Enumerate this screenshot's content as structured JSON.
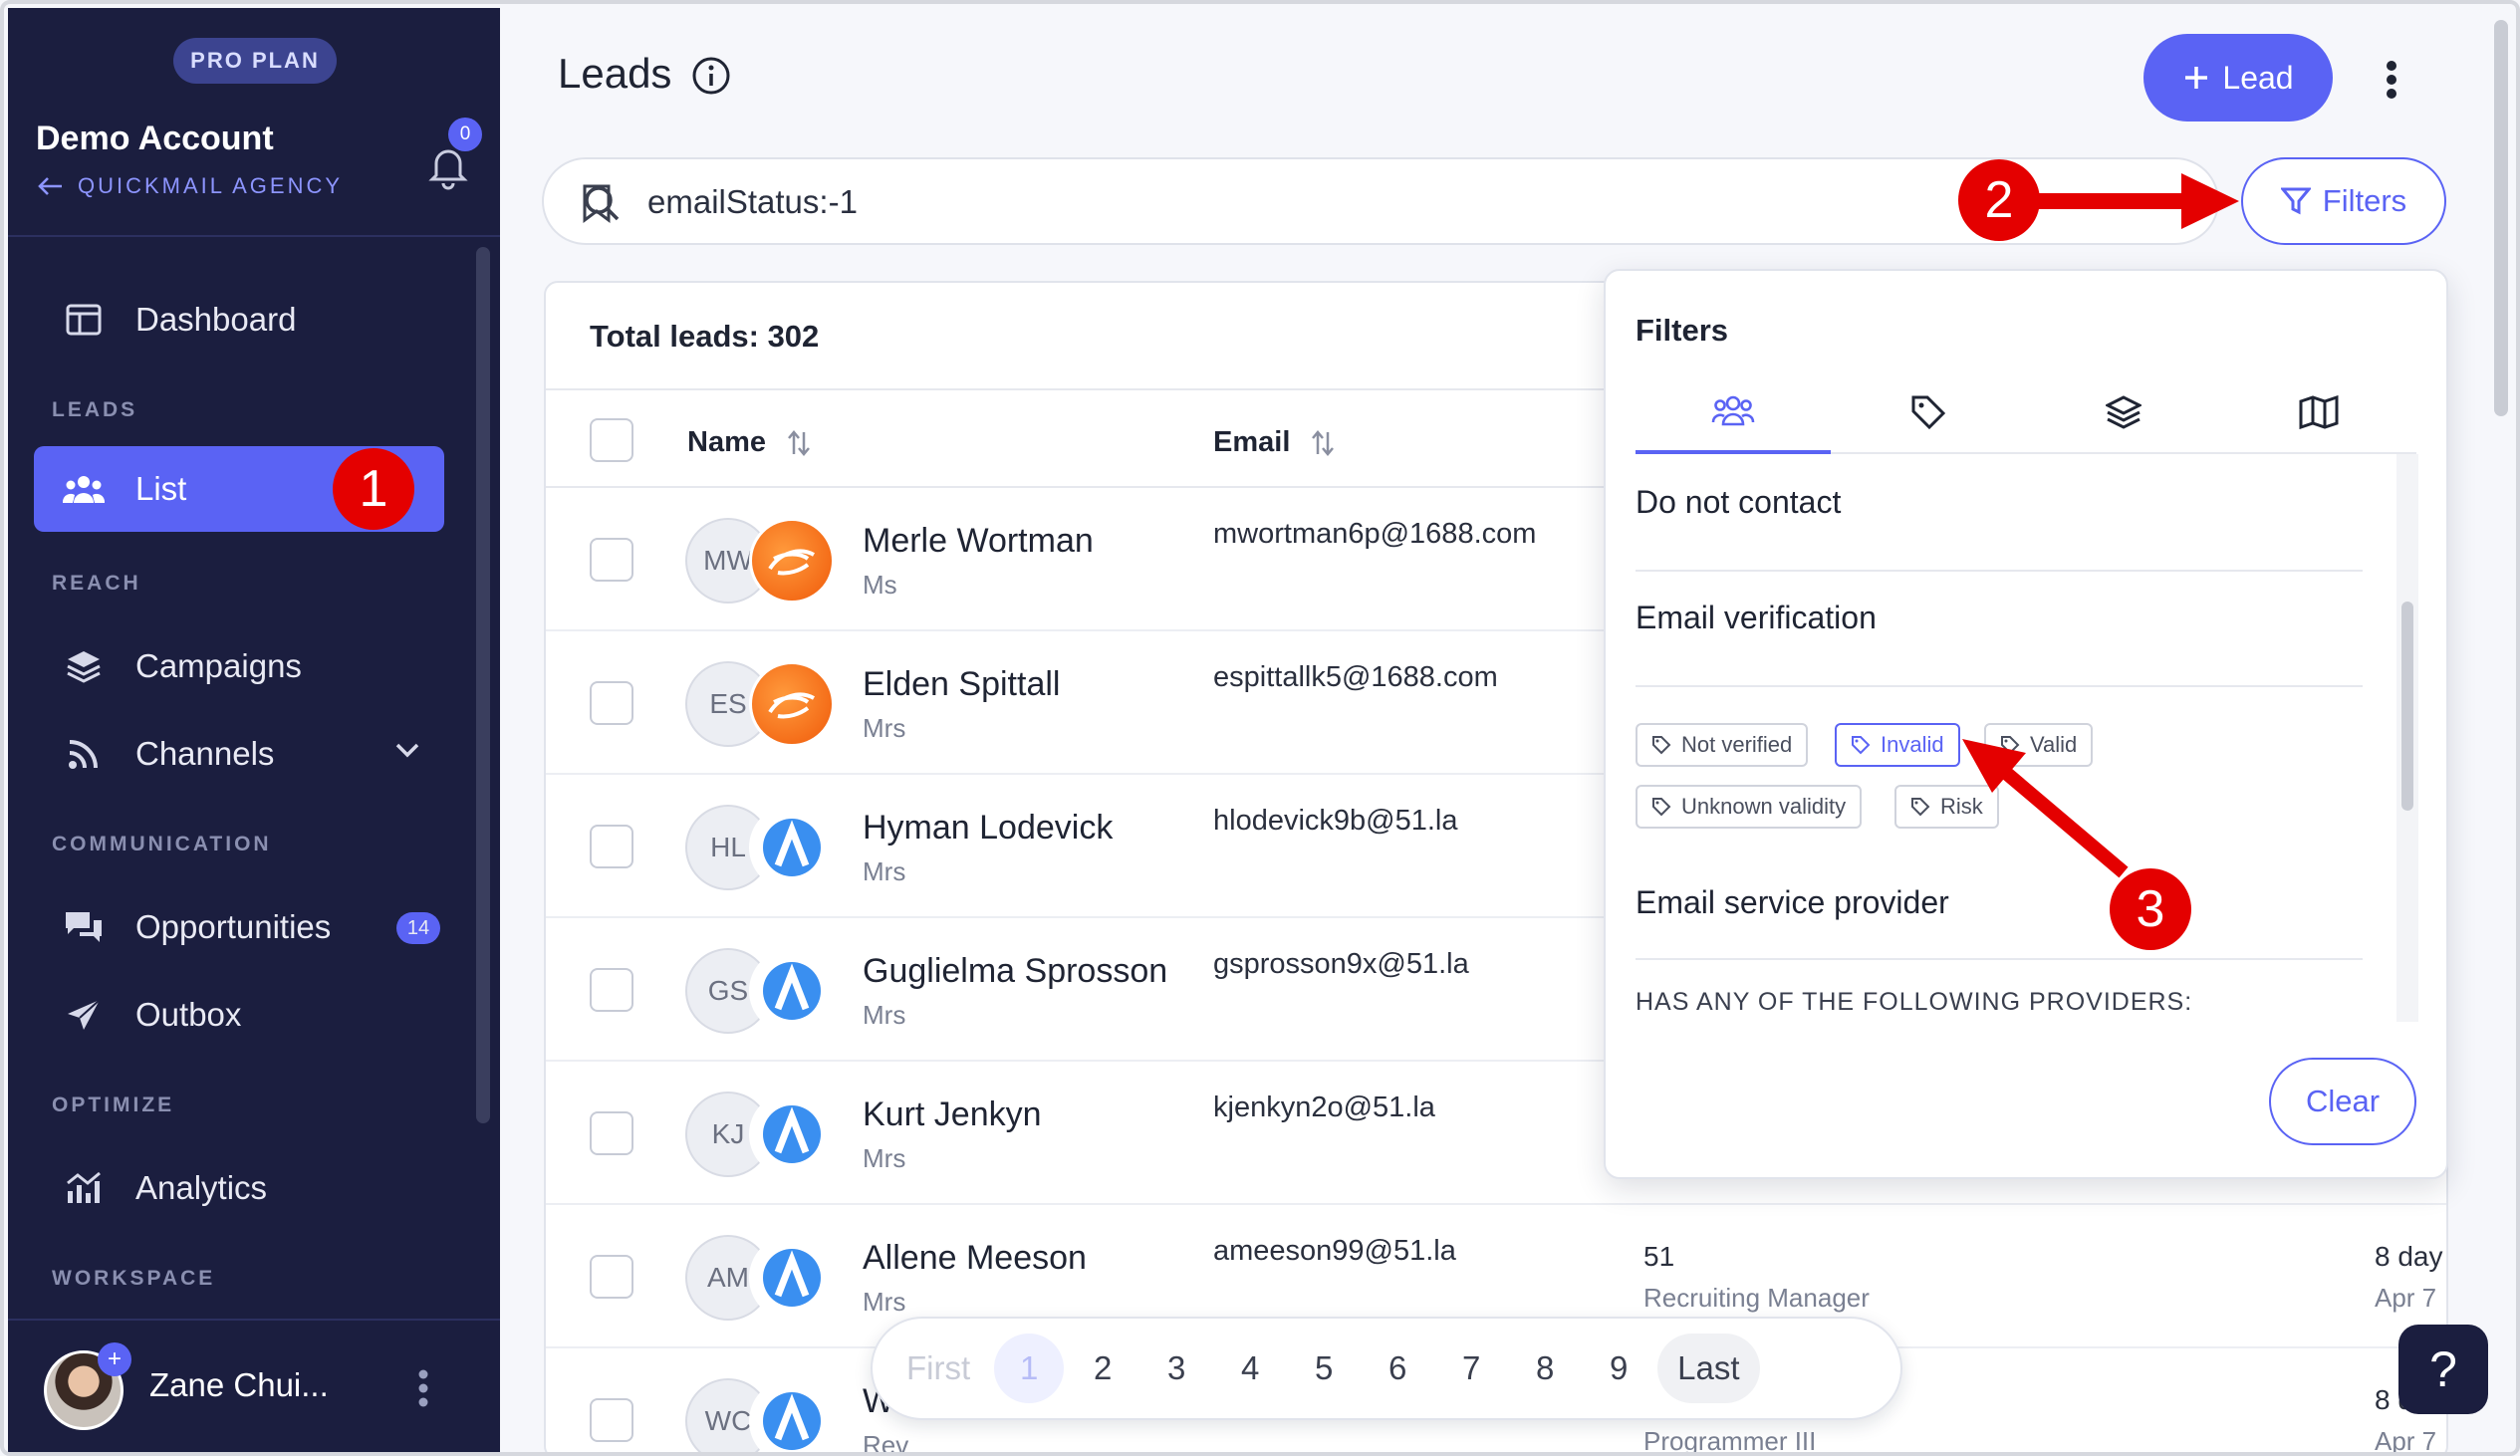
{
  "sidebar": {
    "plan_badge": "PRO PLAN",
    "account_name": "Demo Account",
    "agency_link": "QUICKMAIL AGENCY",
    "notification_count": "0",
    "sections": {
      "leads": "LEADS",
      "reach": "REACH",
      "communication": "COMMUNICATION",
      "optimize": "OPTIMIZE",
      "workspace": "WORKSPACE"
    },
    "items": {
      "dashboard": "Dashboard",
      "list": "List",
      "campaigns": "Campaigns",
      "channels": "Channels",
      "opportunities": "Opportunities",
      "opportunities_count": "14",
      "outbox": "Outbox",
      "analytics": "Analytics"
    },
    "user_name": "Zane Chui..."
  },
  "header": {
    "title": "Leads",
    "add_lead_label": "Lead"
  },
  "search": {
    "value": "emailStatus:-1",
    "filters_label": "Filters"
  },
  "table": {
    "total_label": "Total leads: 302",
    "columns": {
      "name": "Name",
      "email": "Email"
    },
    "rows": [
      {
        "initials": "MW",
        "name": "Merle Wortman",
        "title": "Ms",
        "email": "mwortman6p@1688.com",
        "logo": "1688-logo",
        "company": "",
        "role": "",
        "ago": "",
        "date": ""
      },
      {
        "initials": "ES",
        "name": "Elden Spittall",
        "title": "Mrs",
        "email": "espittallk5@1688.com",
        "logo": "1688-logo",
        "company": "",
        "role": "",
        "ago": "",
        "date": ""
      },
      {
        "initials": "HL",
        "name": "Hyman Lodevick",
        "title": "Mrs",
        "email": "hlodevick9b@51.la",
        "logo": "51la-logo",
        "company": "",
        "role": "",
        "ago": "",
        "date": ""
      },
      {
        "initials": "GS",
        "name": "Guglielma Sprosson",
        "title": "Mrs",
        "email": "gsprosson9x@51.la",
        "logo": "51la-logo",
        "company": "",
        "role": "",
        "ago": "",
        "date": ""
      },
      {
        "initials": "KJ",
        "name": "Kurt Jenkyn",
        "title": "Mrs",
        "email": "kjenkyn2o@51.la",
        "logo": "51la-logo",
        "company": "",
        "role": "",
        "ago": "",
        "date": ""
      },
      {
        "initials": "AM",
        "name": "Allene Meeson",
        "title": "Mrs",
        "email": "ameeson99@51.la",
        "logo": "51la-logo",
        "company": "51",
        "role": "Recruiting Manager",
        "ago": "8 day",
        "date": "Apr 7"
      },
      {
        "initials": "WC",
        "name": "W",
        "title": "Rev",
        "email": "",
        "logo": "51la-logo",
        "company": "",
        "role": "Programmer III",
        "ago": "8 d",
        "date": "Apr 7"
      }
    ]
  },
  "pagination": {
    "first": "First",
    "pages": [
      "1",
      "2",
      "3",
      "4",
      "5",
      "6",
      "7",
      "8",
      "9"
    ],
    "last": "Last"
  },
  "filters_panel": {
    "title": "Filters",
    "tab_icons": [
      "people-icon",
      "tag-icon",
      "layers-icon",
      "map-icon"
    ],
    "sections": {
      "do_not_contact": "Do not contact",
      "email_verification": "Email verification",
      "email_service_provider": "Email service provider"
    },
    "verification_tags": [
      "Not verified",
      "Invalid",
      "Valid",
      "Unknown validity",
      "Risk"
    ],
    "provider_caption": "HAS ANY OF THE FOLLOWING PROVIDERS:",
    "clear_label": "Clear"
  },
  "annotations": [
    "1",
    "2",
    "3"
  ],
  "help_label": "?",
  "colors": {
    "sidebar_bg": "#1b1e3f",
    "accent": "#5a63f4",
    "annotation_red": "#e40000"
  }
}
